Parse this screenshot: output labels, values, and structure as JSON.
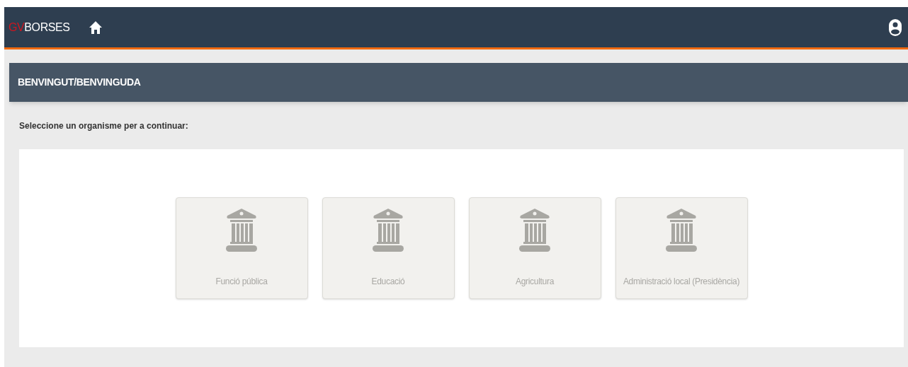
{
  "navbar": {
    "logo": {
      "prefix": "GV",
      "name": "BORSES"
    }
  },
  "panel": {
    "title": "BENVINGUT/BENVINGUDA"
  },
  "instruction": "Seleccione un organisme per a continuar:",
  "organisms": [
    {
      "label": "Funció pública"
    },
    {
      "label": "Educació"
    },
    {
      "label": "Agricultura"
    },
    {
      "label": "Administració local (Presidència)"
    }
  ]
}
